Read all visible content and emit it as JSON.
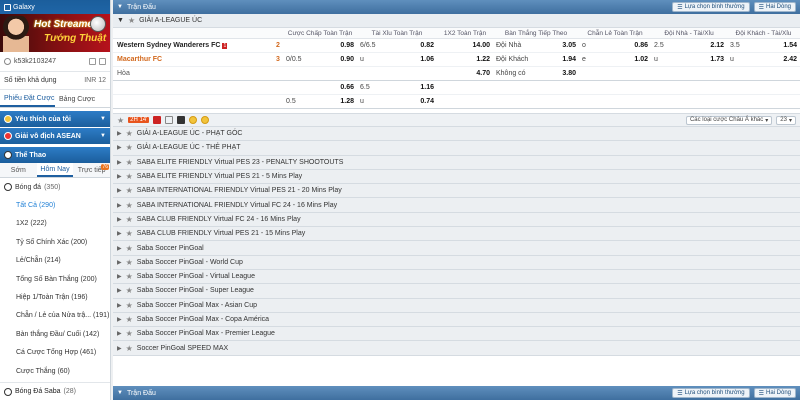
{
  "sidebar": {
    "galaxy": "Galaxy",
    "banner_line1": "Hot Streamer",
    "banner_line2": "Tướng Thuật",
    "username": "k53k2103247",
    "balance_label": "Số tiền khả dụng",
    "balance_currency": "INR 12",
    "slip_tabs": [
      "Phiếu Đặt Cược",
      "Bảng Cược"
    ],
    "favorites": "Yêu thích của tôi",
    "asean": "Giải vô địch ASEAN",
    "sports": "Thể Thao",
    "time_tabs": [
      "Sớm",
      "Hôm Nay",
      "Trực tiếp"
    ],
    "live_badge": "76",
    "football": "Bóng đá",
    "football_count": "(350)",
    "markets": [
      "Tất Cả (290)",
      "1X2 (222)",
      "Tỷ Số Chính Xác (200)",
      "Lẻ/Chẵn (214)",
      "Tổng Số Bàn Thắng (200)",
      "Hiệp 1/Toàn Trận (196)",
      "Chẵn / Lẻ của Nửa trậ... (191)",
      "Bàn thắng Đầu/ Cuối (142)",
      "Cá Cược Tổng Hợp (461)",
      "Cược Thắng (60)"
    ],
    "saba": "Bóng Đá Saba",
    "saba_count": "(28)"
  },
  "main": {
    "section_title": "Trận Đấu",
    "select_view": "Lựa chọn bình thường",
    "select_rows": "Hai Dòng",
    "league": "GIẢI A-LEAGUE ÚC",
    "headers": [
      "Cược Chấp Toàn Trận",
      "Tài Xỉu Toàn Trận",
      "1X2 Toàn Trận",
      "Bàn Thắng Tiếp Theo",
      "Chẵn Lẻ Toàn Trận",
      "Đội Nhà - Tài/Xỉu",
      "Đội Khách - Tài/Xỉu"
    ],
    "team1": "Western Sydney Wanderers FC",
    "team1_card": "1",
    "team1_score": "2",
    "team2": "Macarthur FC",
    "team2_score": "3",
    "draw": "Hòa",
    "r1": {
      "hdp": "",
      "hdp_odd": "0.98",
      "ou": "6/6.5",
      "ou_odd": "0.82",
      "x12": "14.00",
      "ng_lab": "Đội Nhà",
      "ng_odd": "3.05",
      "oe_lab": "o",
      "oe_odd": "0.86",
      "h_lab": "2.5",
      "h_odd": "2.12",
      "a_lab": "3.5",
      "a_odd": "1.54"
    },
    "r2": {
      "hdp": "0/0.5",
      "hdp_odd": "0.90",
      "ou": "u",
      "ou_odd": "1.06",
      "x12": "1.22",
      "ng_lab": "Đội Khách",
      "ng_odd": "1.94",
      "oe_lab": "e",
      "oe_odd": "1.02",
      "h_lab": "u",
      "h_odd": "1.73",
      "a_lab": "u",
      "a_odd": "2.42"
    },
    "r3": {
      "x12": "4.70",
      "ng_lab": "Không có",
      "ng_odd": "3.80"
    },
    "r4": {
      "hdp_odd": "0.66",
      "ou": "6.5",
      "ou_odd": "1.16"
    },
    "r5": {
      "hdp": "0.5",
      "hdp_odd": "1.28",
      "ou": "u",
      "ou_odd": "0.74"
    },
    "live_time": "2H 14'",
    "asian_select": "Các loại cược Châu Á khác",
    "count_select": "23",
    "leagues": [
      "GIẢI A-LEAGUE ÚC - PHẠT GÓC",
      "GIẢI A-LEAGUE ÚC - THẺ PHẠT",
      "SABA ELITE FRIENDLY Virtual PES 23 - PENALTY SHOOTOUTS",
      "SABA ELITE FRIENDLY Virtual PES 21 - 5 Mins Play",
      "SABA INTERNATIONAL FRIENDLY Virtual PES 21 - 20 Mins Play",
      "SABA INTERNATIONAL FRIENDLY Virtual FC 24 - 16 Mins Play",
      "SABA CLUB FRIENDLY Virtual FC 24 - 16 Mins Play",
      "SABA CLUB FRIENDLY Virtual PES 21 - 15 Mins Play",
      "Saba Soccer PinGoal",
      "Saba Soccer PinGoal - World Cup",
      "Saba Soccer PinGoal - Virtual League",
      "Saba Soccer PinGoal - Super League",
      "Saba Soccer PinGoal Max - Asian Cup",
      "Saba Soccer PinGoal Max - Copa América",
      "Saba Soccer PinGoal Max - Premier League",
      "Soccer PinGoal SPEED MAX"
    ],
    "bottom_title": "Trận Đấu"
  }
}
